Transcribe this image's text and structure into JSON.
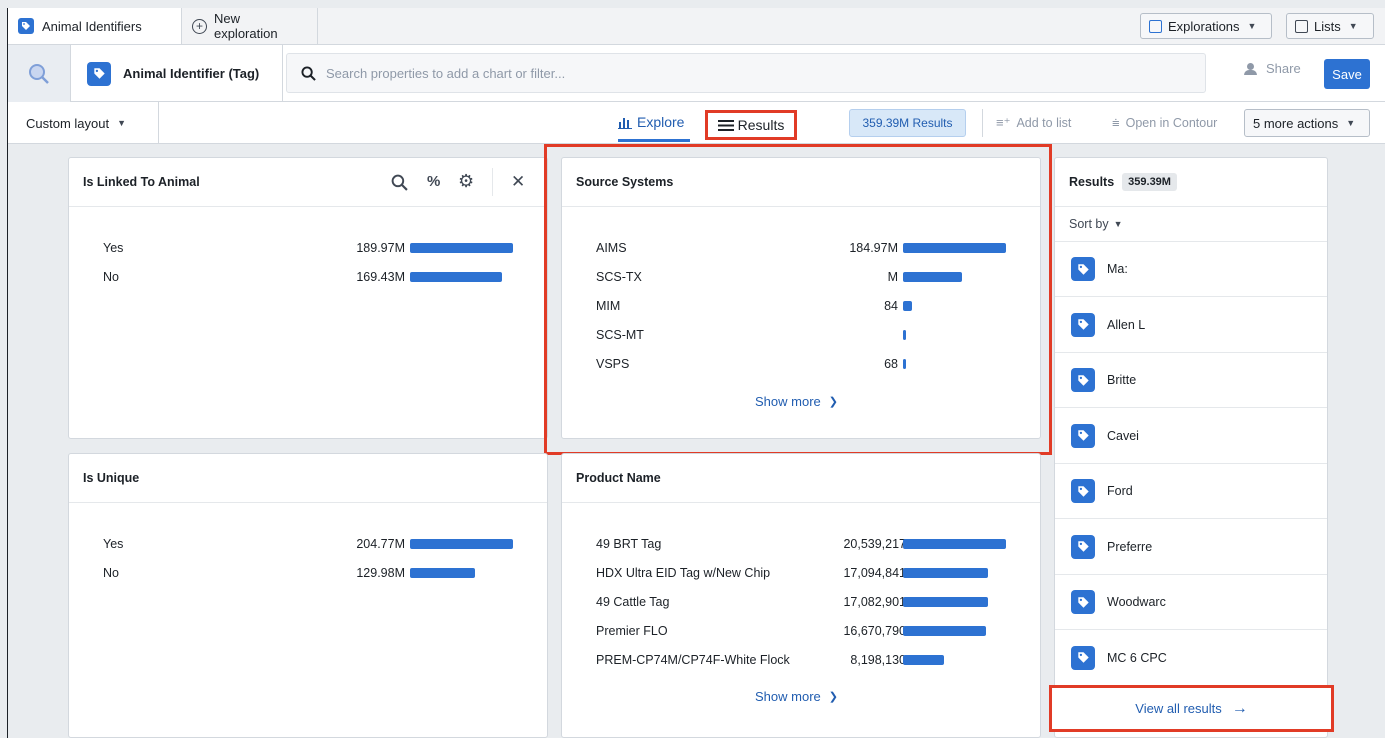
{
  "tabs": [
    {
      "label": "Animal Identifiers"
    },
    {
      "label": "New exploration"
    }
  ],
  "top_right": {
    "explorations_label": "Explorations",
    "lists_label": "Lists"
  },
  "header": {
    "object_type": "Animal Identifier (Tag)",
    "search_placeholder": "Search properties to add a chart or filter...",
    "share_label": "Share",
    "save_label": "Save"
  },
  "toolbar": {
    "layout_label": "Custom layout",
    "explore_label": "Explore",
    "results_label": "Results",
    "results_count": "359.39M Results",
    "add_to_list": "Add to list",
    "open_contour": "Open in Contour",
    "more_actions": "5 more actions"
  },
  "cards": {
    "linked": {
      "title": "Is Linked To Animal",
      "rows": [
        {
          "label": "Yes",
          "value": "189.97M",
          "fraction": 1.0
        },
        {
          "label": "No",
          "value": "169.43M",
          "fraction": 0.89
        }
      ]
    },
    "source": {
      "title": "Source Systems",
      "rows": [
        {
          "label": "AIMS",
          "value": "184.97M",
          "fraction": 1.0
        },
        {
          "label": "SCS-TX",
          "value": "M",
          "fraction": 0.57
        },
        {
          "label": "MIM",
          "value": "84",
          "fraction": 0.09
        },
        {
          "label": "SCS-MT",
          "value": "",
          "fraction": 0.03
        },
        {
          "label": "VSPS",
          "value": "68",
          "fraction": 0.02
        }
      ],
      "show_more": "Show more"
    },
    "unique": {
      "title": "Is Unique",
      "rows": [
        {
          "label": "Yes",
          "value": "204.77M",
          "fraction": 1.0
        },
        {
          "label": "No",
          "value": "129.98M",
          "fraction": 0.63
        }
      ]
    },
    "product": {
      "title": "Product Name",
      "rows": [
        {
          "label": "49 BRT Tag",
          "value": "20,539,217",
          "fraction": 1.0
        },
        {
          "label": "HDX Ultra EID Tag w/New Chip",
          "value": "17,094,841",
          "fraction": 0.83
        },
        {
          "label": "49 Cattle Tag",
          "value": "17,082,901",
          "fraction": 0.83
        },
        {
          "label": "Premier FLO",
          "value": "16,670,790",
          "fraction": 0.81
        },
        {
          "label": "PREM-CP74M/CP74F-White Flock",
          "value": "8,198,130",
          "fraction": 0.4
        }
      ],
      "show_more": "Show more"
    }
  },
  "results_panel": {
    "title": "Results",
    "count": "359.39M",
    "sort_label": "Sort by",
    "items": [
      "Ma:",
      "Allen L",
      "Britte",
      "Cavei",
      "Ford",
      "Preferre",
      "Woodwarc",
      "MC 6 CPC"
    ],
    "view_all": "View all results"
  },
  "colors": {
    "accent": "#2d72d2",
    "highlight": "#e13b26"
  }
}
